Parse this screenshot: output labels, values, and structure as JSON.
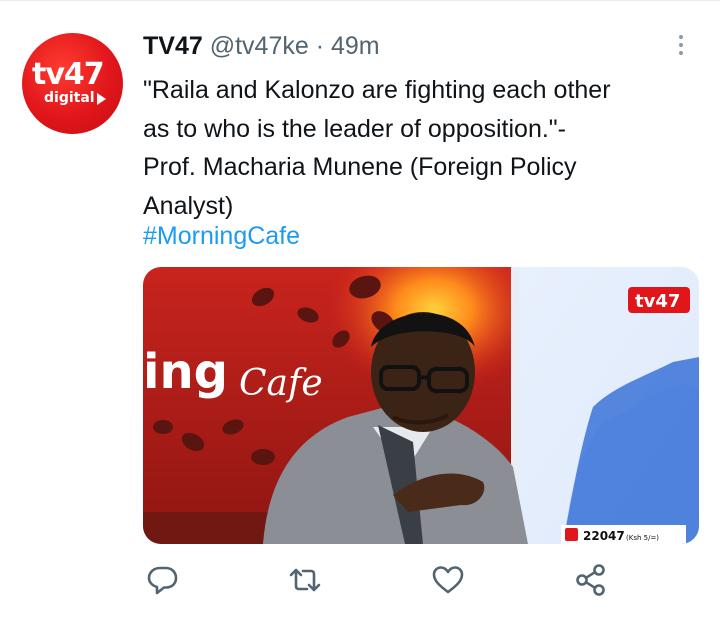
{
  "tweet": {
    "author_name": "TV47",
    "handle": "@tv47ke",
    "separator": "·",
    "time": "49m",
    "avatar_text_top": "tv47",
    "avatar_text_bottom": "digital",
    "text_lines": [
      "\"Raila and Kalonzo are fighting each other",
      "as to who is the leader of opposition.\"-",
      "Prof. Macharia Munene (Foreign Policy",
      "Analyst)"
    ],
    "hashtag": "#MorningCafe"
  },
  "media": {
    "studio_text": "ing",
    "cafe_text": "Cafe",
    "channel_logo": "tv47",
    "ticker_number": "22047",
    "ticker_suffix": "(Ksh 5/=)"
  },
  "actions": {
    "reply_icon": "reply-icon",
    "retweet_icon": "retweet-icon",
    "like_icon": "like-icon",
    "share_icon": "share-icon"
  },
  "colors": {
    "accent": "#1d9bf0",
    "text": "#0f1419",
    "secondary": "#536471",
    "brand_red": "#e0161b"
  }
}
